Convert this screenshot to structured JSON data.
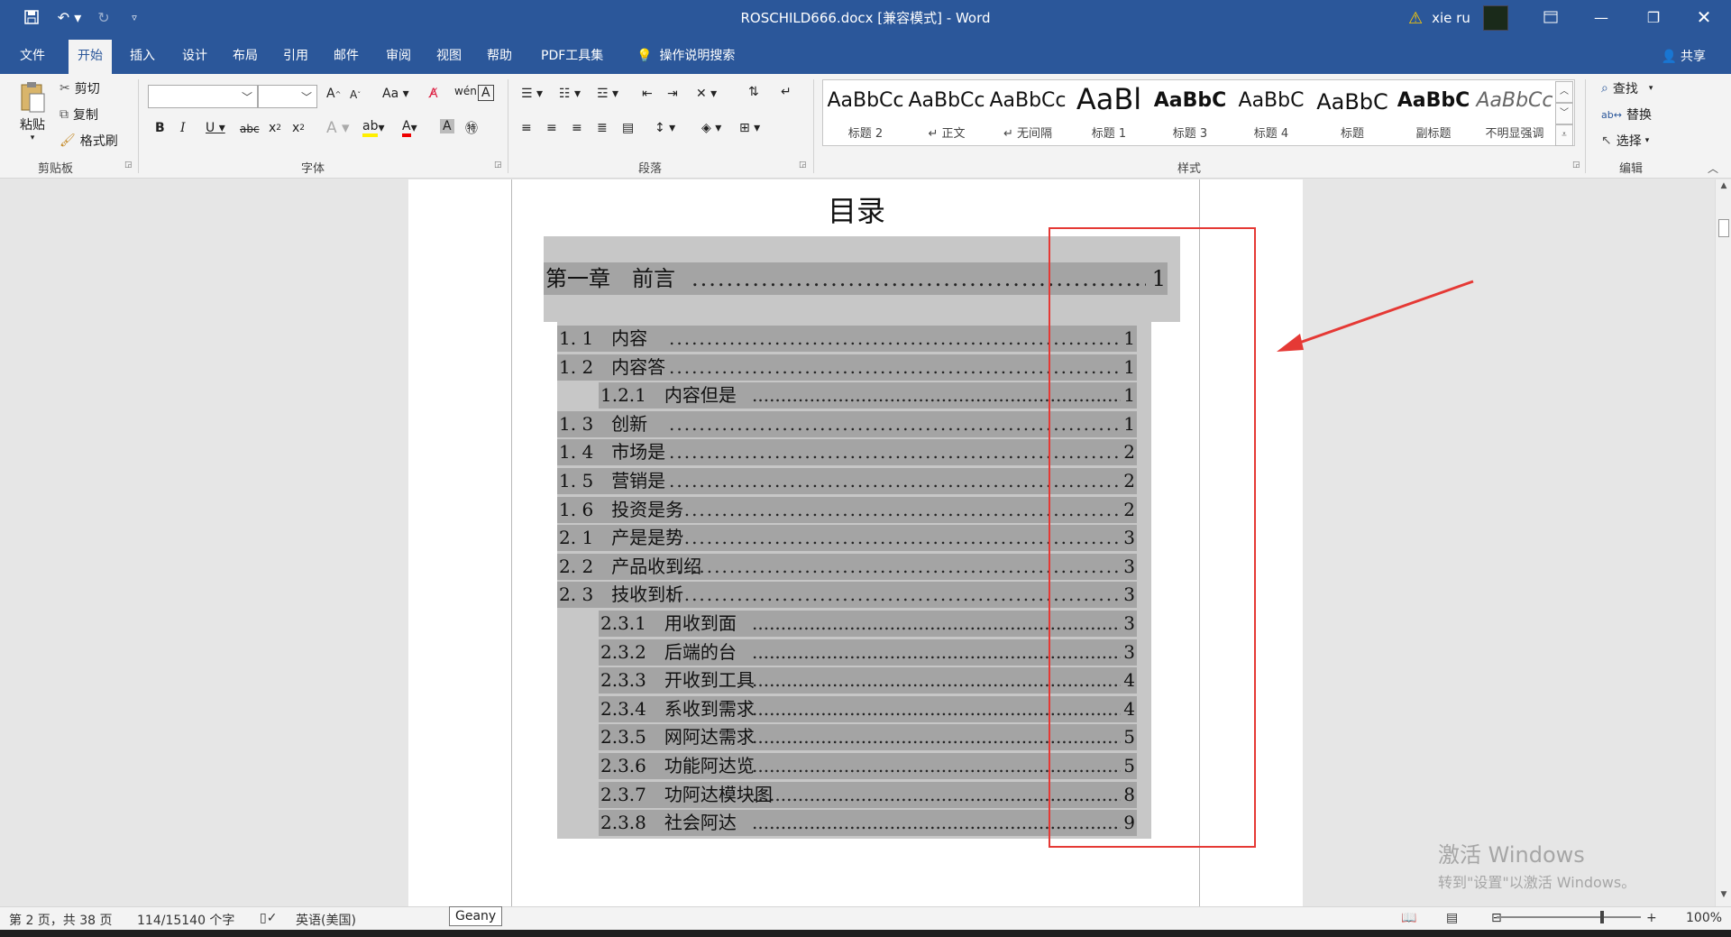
{
  "window": {
    "title": "ROSCHILD666.docx [兼容模式]  -  Word",
    "user": "xie ru"
  },
  "tabs": [
    "文件",
    "开始",
    "插入",
    "设计",
    "布局",
    "引用",
    "邮件",
    "审阅",
    "视图",
    "帮助",
    "PDF工具集"
  ],
  "search_tell": "操作说明搜索",
  "share": "共享",
  "ribbon": {
    "clipboard": {
      "paste": "粘贴",
      "cut": "剪切",
      "copy": "复制",
      "format_painter": "格式刷",
      "label": "剪贴板"
    },
    "font": {
      "label": "字体",
      "font_name": "",
      "font_size": ""
    },
    "paragraph": {
      "label": "段落"
    },
    "styles": {
      "label": "样式",
      "items": [
        {
          "preview": "AaBbCc",
          "name": "标题 2"
        },
        {
          "preview": "AaBbCc",
          "name": "↵ 正文"
        },
        {
          "preview": "AaBbCc",
          "name": "↵ 无间隔"
        },
        {
          "preview": "AaBl",
          "name": "标题 1"
        },
        {
          "preview": "AaBbC",
          "name": "标题 3"
        },
        {
          "preview": "AaBbC",
          "name": "标题 4"
        },
        {
          "preview": "AaBbC",
          "name": "标题"
        },
        {
          "preview": "AaBbC",
          "name": "副标题"
        },
        {
          "preview": "AaBbCc",
          "name": "不明显强调"
        }
      ]
    },
    "editing": {
      "label": "编辑",
      "find": "查找",
      "replace": "替换",
      "select": "选择"
    }
  },
  "document": {
    "toc_title": "目录",
    "chapter": {
      "title": "第一章　前言",
      "page": "1"
    },
    "entries": [
      {
        "title": "1. 1　内容",
        "page": "1",
        "level": 2
      },
      {
        "title": "1. 2　内容答",
        "page": "1",
        "level": 2
      },
      {
        "title": "1.2.1　内容但是",
        "page": "1",
        "level": 3
      },
      {
        "title": "1. 3　创新",
        "page": "1",
        "level": 2
      },
      {
        "title": "1. 4　市场是",
        "page": "2",
        "level": 2
      },
      {
        "title": "1. 5　营销是",
        "page": "2",
        "level": 2
      },
      {
        "title": "1. 6　投资是务",
        "page": "2",
        "level": 2
      },
      {
        "title": "2. 1　产是是势",
        "page": "3",
        "level": 2
      },
      {
        "title": "2. 2　产品收到绍",
        "page": "3",
        "level": 2
      },
      {
        "title": "2. 3　技收到析",
        "page": "3",
        "level": 2
      },
      {
        "title": "2.3.1　用收到面",
        "page": "3",
        "level": 3
      },
      {
        "title": "2.3.2　后端的台",
        "page": "3",
        "level": 3
      },
      {
        "title": "2.3.3　开收到工具",
        "page": "4",
        "level": 3
      },
      {
        "title": "2.3.4　系收到需求",
        "page": "4",
        "level": 3
      },
      {
        "title": "2.3.5　网阿达需求",
        "page": "5",
        "level": 3
      },
      {
        "title": "2.3.6　功能阿达览",
        "page": "5",
        "level": 3
      },
      {
        "title": "2.3.7　功阿达模块图",
        "page": "8",
        "level": 3
      },
      {
        "title": "2.3.8　社会阿达",
        "page": "9",
        "level": 3
      }
    ]
  },
  "watermark": {
    "line1": "激活 Windows",
    "line2": "转到\"设置\"以激活 Windows。"
  },
  "status": {
    "page": "第 2 页，共 38 页",
    "words": "114/15140 个字",
    "language": "英语(美国)",
    "tooltip": "Geany",
    "zoom": "100%"
  },
  "colors": {
    "accent": "#2b579a",
    "highlight": "#e53935"
  }
}
